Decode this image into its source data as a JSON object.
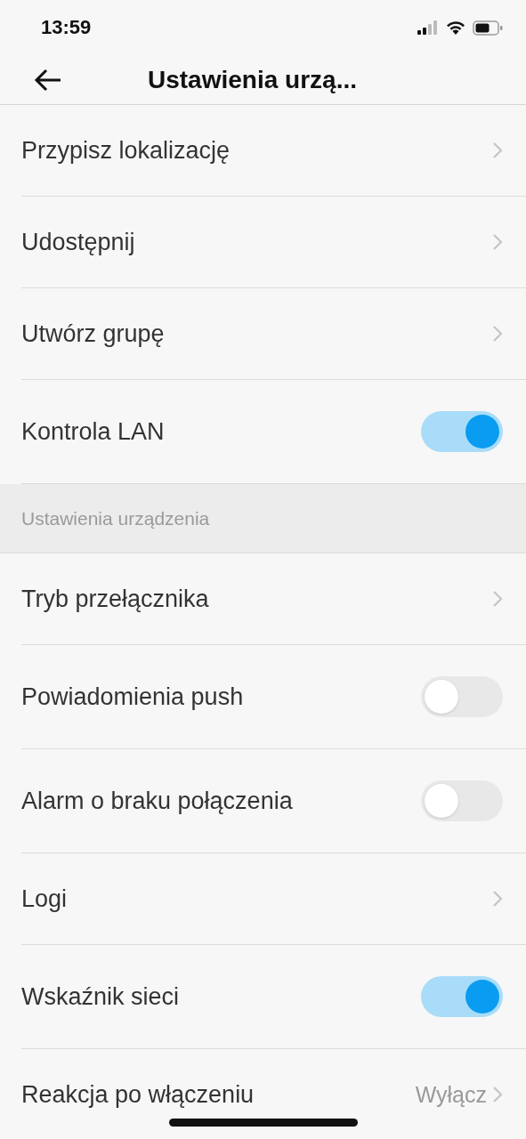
{
  "status_bar": {
    "time": "13:59"
  },
  "header": {
    "title": "Ustawienia urzą..."
  },
  "groups": [
    {
      "items": [
        {
          "kind": "link",
          "label": "Przypisz lokalizację"
        },
        {
          "kind": "link",
          "label": "Udostępnij"
        },
        {
          "kind": "link",
          "label": "Utwórz grupę"
        },
        {
          "kind": "toggle",
          "label": "Kontrola LAN",
          "on": true
        }
      ]
    },
    {
      "title": "Ustawienia urządzenia",
      "items": [
        {
          "kind": "link",
          "label": "Tryb przełącznika"
        },
        {
          "kind": "toggle",
          "label": "Powiadomienia push",
          "on": false
        },
        {
          "kind": "toggle",
          "label": "Alarm o braku połączenia",
          "on": false
        },
        {
          "kind": "link",
          "label": "Logi"
        },
        {
          "kind": "toggle",
          "label": "Wskaźnik sieci",
          "on": true
        },
        {
          "kind": "link",
          "label": "Reakcja po włączeniu",
          "value": "Wyłącz"
        }
      ]
    }
  ]
}
